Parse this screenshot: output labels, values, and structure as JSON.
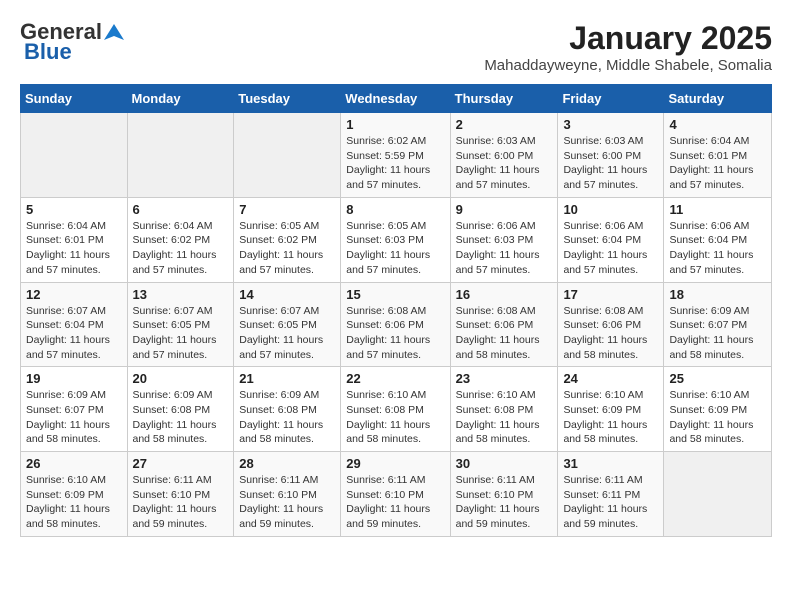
{
  "header": {
    "logo_general": "General",
    "logo_blue": "Blue",
    "month": "January 2025",
    "location": "Mahaddayweyne, Middle Shabele, Somalia"
  },
  "weekdays": [
    "Sunday",
    "Monday",
    "Tuesday",
    "Wednesday",
    "Thursday",
    "Friday",
    "Saturday"
  ],
  "weeks": [
    [
      {
        "day": "",
        "info": ""
      },
      {
        "day": "",
        "info": ""
      },
      {
        "day": "",
        "info": ""
      },
      {
        "day": "1",
        "info": "Sunrise: 6:02 AM\nSunset: 5:59 PM\nDaylight: 11 hours and 57 minutes."
      },
      {
        "day": "2",
        "info": "Sunrise: 6:03 AM\nSunset: 6:00 PM\nDaylight: 11 hours and 57 minutes."
      },
      {
        "day": "3",
        "info": "Sunrise: 6:03 AM\nSunset: 6:00 PM\nDaylight: 11 hours and 57 minutes."
      },
      {
        "day": "4",
        "info": "Sunrise: 6:04 AM\nSunset: 6:01 PM\nDaylight: 11 hours and 57 minutes."
      }
    ],
    [
      {
        "day": "5",
        "info": "Sunrise: 6:04 AM\nSunset: 6:01 PM\nDaylight: 11 hours and 57 minutes."
      },
      {
        "day": "6",
        "info": "Sunrise: 6:04 AM\nSunset: 6:02 PM\nDaylight: 11 hours and 57 minutes."
      },
      {
        "day": "7",
        "info": "Sunrise: 6:05 AM\nSunset: 6:02 PM\nDaylight: 11 hours and 57 minutes."
      },
      {
        "day": "8",
        "info": "Sunrise: 6:05 AM\nSunset: 6:03 PM\nDaylight: 11 hours and 57 minutes."
      },
      {
        "day": "9",
        "info": "Sunrise: 6:06 AM\nSunset: 6:03 PM\nDaylight: 11 hours and 57 minutes."
      },
      {
        "day": "10",
        "info": "Sunrise: 6:06 AM\nSunset: 6:04 PM\nDaylight: 11 hours and 57 minutes."
      },
      {
        "day": "11",
        "info": "Sunrise: 6:06 AM\nSunset: 6:04 PM\nDaylight: 11 hours and 57 minutes."
      }
    ],
    [
      {
        "day": "12",
        "info": "Sunrise: 6:07 AM\nSunset: 6:04 PM\nDaylight: 11 hours and 57 minutes."
      },
      {
        "day": "13",
        "info": "Sunrise: 6:07 AM\nSunset: 6:05 PM\nDaylight: 11 hours and 57 minutes."
      },
      {
        "day": "14",
        "info": "Sunrise: 6:07 AM\nSunset: 6:05 PM\nDaylight: 11 hours and 57 minutes."
      },
      {
        "day": "15",
        "info": "Sunrise: 6:08 AM\nSunset: 6:06 PM\nDaylight: 11 hours and 57 minutes."
      },
      {
        "day": "16",
        "info": "Sunrise: 6:08 AM\nSunset: 6:06 PM\nDaylight: 11 hours and 58 minutes."
      },
      {
        "day": "17",
        "info": "Sunrise: 6:08 AM\nSunset: 6:06 PM\nDaylight: 11 hours and 58 minutes."
      },
      {
        "day": "18",
        "info": "Sunrise: 6:09 AM\nSunset: 6:07 PM\nDaylight: 11 hours and 58 minutes."
      }
    ],
    [
      {
        "day": "19",
        "info": "Sunrise: 6:09 AM\nSunset: 6:07 PM\nDaylight: 11 hours and 58 minutes."
      },
      {
        "day": "20",
        "info": "Sunrise: 6:09 AM\nSunset: 6:08 PM\nDaylight: 11 hours and 58 minutes."
      },
      {
        "day": "21",
        "info": "Sunrise: 6:09 AM\nSunset: 6:08 PM\nDaylight: 11 hours and 58 minutes."
      },
      {
        "day": "22",
        "info": "Sunrise: 6:10 AM\nSunset: 6:08 PM\nDaylight: 11 hours and 58 minutes."
      },
      {
        "day": "23",
        "info": "Sunrise: 6:10 AM\nSunset: 6:08 PM\nDaylight: 11 hours and 58 minutes."
      },
      {
        "day": "24",
        "info": "Sunrise: 6:10 AM\nSunset: 6:09 PM\nDaylight: 11 hours and 58 minutes."
      },
      {
        "day": "25",
        "info": "Sunrise: 6:10 AM\nSunset: 6:09 PM\nDaylight: 11 hours and 58 minutes."
      }
    ],
    [
      {
        "day": "26",
        "info": "Sunrise: 6:10 AM\nSunset: 6:09 PM\nDaylight: 11 hours and 58 minutes."
      },
      {
        "day": "27",
        "info": "Sunrise: 6:11 AM\nSunset: 6:10 PM\nDaylight: 11 hours and 59 minutes."
      },
      {
        "day": "28",
        "info": "Sunrise: 6:11 AM\nSunset: 6:10 PM\nDaylight: 11 hours and 59 minutes."
      },
      {
        "day": "29",
        "info": "Sunrise: 6:11 AM\nSunset: 6:10 PM\nDaylight: 11 hours and 59 minutes."
      },
      {
        "day": "30",
        "info": "Sunrise: 6:11 AM\nSunset: 6:10 PM\nDaylight: 11 hours and 59 minutes."
      },
      {
        "day": "31",
        "info": "Sunrise: 6:11 AM\nSunset: 6:11 PM\nDaylight: 11 hours and 59 minutes."
      },
      {
        "day": "",
        "info": ""
      }
    ]
  ]
}
